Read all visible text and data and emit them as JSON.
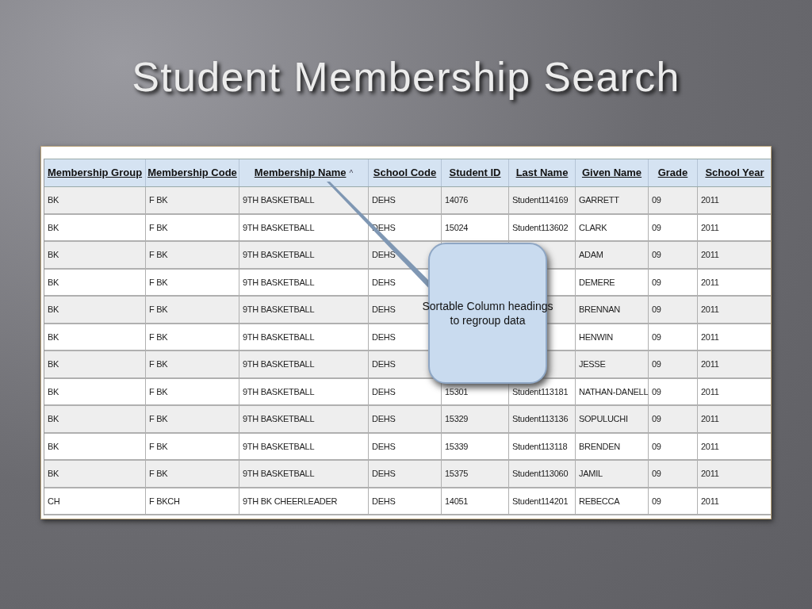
{
  "slide": {
    "title": "Student Membership Search"
  },
  "table": {
    "columns": [
      {
        "label": "Membership Group"
      },
      {
        "label": "Membership Code"
      },
      {
        "label": "Membership Name",
        "sort_indicator": "^"
      },
      {
        "label": "School Code"
      },
      {
        "label": "Student ID"
      },
      {
        "label": "Last Name"
      },
      {
        "label": "Given Name"
      },
      {
        "label": "Grade"
      },
      {
        "label": "School Year"
      }
    ],
    "rows": [
      [
        "BK",
        "F BK",
        "9TH BASKETBALL",
        "DEHS",
        "14076",
        "Student114169",
        "GARRETT",
        "09",
        "2011"
      ],
      [
        "BK",
        "F BK",
        "9TH BASKETBALL",
        "DEHS",
        "15024",
        "Student113602",
        "CLARK",
        "09",
        "2011"
      ],
      [
        "BK",
        "F BK",
        "9TH BASKETBALL",
        "DEHS",
        null,
        null,
        "ADAM",
        "09",
        "2011"
      ],
      [
        "BK",
        "F BK",
        "9TH BASKETBALL",
        "DEHS",
        null,
        null,
        "DEMERE",
        "09",
        "2011"
      ],
      [
        "BK",
        "F BK",
        "9TH BASKETBALL",
        "DEHS",
        null,
        null,
        "BRENNAN",
        "09",
        "2011"
      ],
      [
        "BK",
        "F BK",
        "9TH BASKETBALL",
        "DEHS",
        null,
        null,
        "HENWIN",
        "09",
        "2011"
      ],
      [
        "BK",
        "F BK",
        "9TH BASKETBALL",
        "DEHS",
        null,
        null,
        "JESSE",
        "09",
        "2011"
      ],
      [
        "BK",
        "F BK",
        "9TH BASKETBALL",
        "DEHS",
        "15301",
        "Student113181",
        "NATHAN-DANELL",
        "09",
        "2011"
      ],
      [
        "BK",
        "F BK",
        "9TH BASKETBALL",
        "DEHS",
        "15329",
        "Student113136",
        "SOPULUCHI",
        "09",
        "2011"
      ],
      [
        "BK",
        "F BK",
        "9TH BASKETBALL",
        "DEHS",
        "15339",
        "Student113118",
        "BRENDEN",
        "09",
        "2011"
      ],
      [
        "BK",
        "F BK",
        "9TH BASKETBALL",
        "DEHS",
        "15375",
        "Student113060",
        "JAMIL",
        "09",
        "2011"
      ],
      [
        "CH",
        "F BKCH",
        "9TH BK CHEERLEADER",
        "DEHS",
        "14051",
        "Student114201",
        "REBECCA",
        "09",
        "2011"
      ]
    ]
  },
  "callout": {
    "lines": [
      "Sortable Column headings",
      "to regroup data"
    ]
  }
}
